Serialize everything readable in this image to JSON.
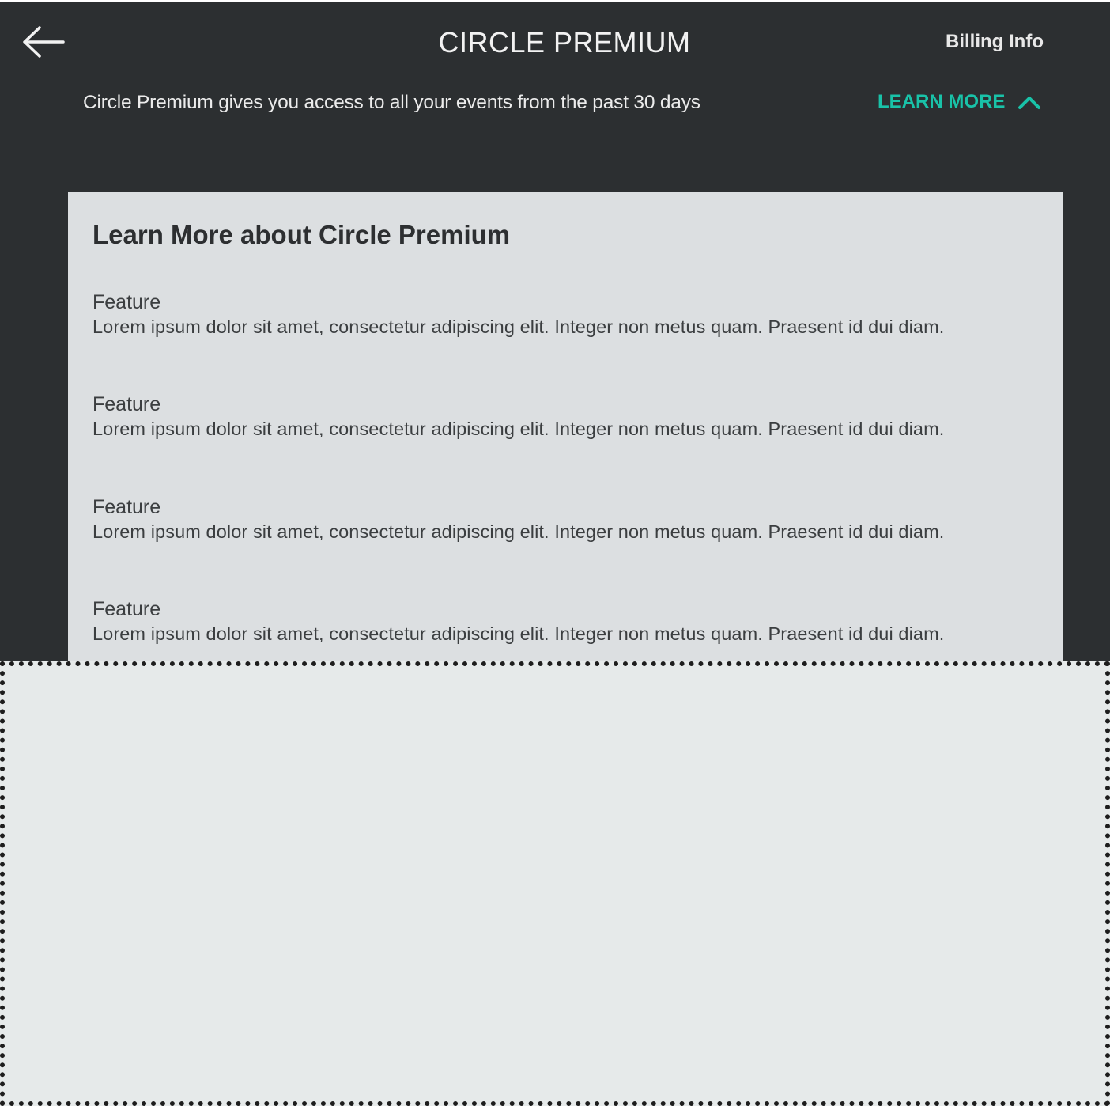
{
  "header": {
    "back_icon": "arrow-left-icon",
    "title": "CIRCLE PREMIUM",
    "billing_label": "Billing Info",
    "subtitle": "Circle Premium gives you access to all your events from the past 30 days",
    "learn_more_label": "LEARN MORE",
    "learn_more_icon": "chevron-up-icon"
  },
  "card": {
    "title": "Learn More about Circle Premium",
    "features": [
      {
        "name": "Feature",
        "description": "Lorem ipsum dolor sit amet, consectetur adipiscing elit. Integer non metus quam. Praesent id dui diam."
      },
      {
        "name": "Feature",
        "description": "Lorem ipsum dolor sit amet, consectetur adipiscing elit. Integer non metus quam. Praesent id dui diam."
      },
      {
        "name": "Feature",
        "description": "Lorem ipsum dolor sit amet, consectetur adipiscing elit. Integer non metus quam. Praesent id dui diam."
      },
      {
        "name": "Feature",
        "description": "Lorem ipsum dolor sit amet, consectetur adipiscing elit. Integer non metus quam. Praesent id dui diam."
      }
    ]
  },
  "colors": {
    "header_background": "#2c2f31",
    "accent": "#19c2a8",
    "card_background": "#dcdfe1",
    "placeholder_background": "#e6eaea"
  }
}
